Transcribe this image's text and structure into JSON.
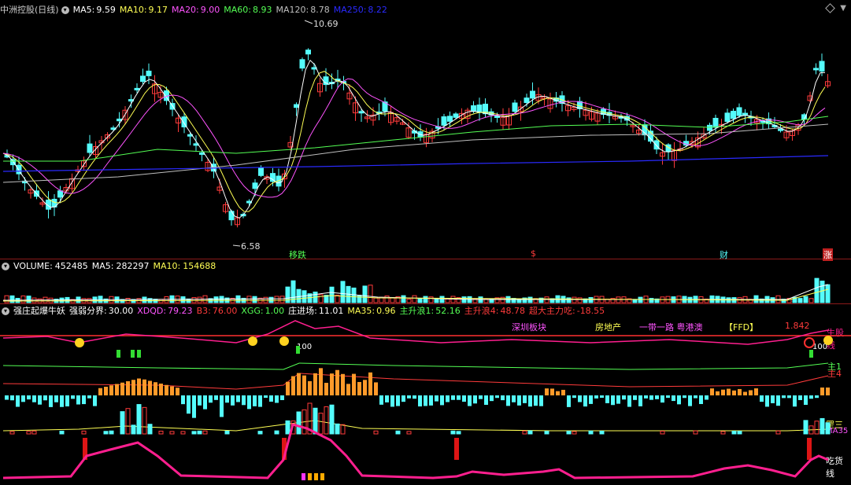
{
  "price_panel": {
    "title": "中洲控股(日线)",
    "ma5_label": "MA5:",
    "ma5": "9.59",
    "ma10_label": "MA10:",
    "ma10": "9.17",
    "ma20_label": "MA20:",
    "ma20": "9.00",
    "ma60_label": "MA60:",
    "ma60": "8.93",
    "ma120_label": "MA120:",
    "ma120": "8.78",
    "ma250_label": "MA250:",
    "ma250": "8.22",
    "high_label": "10.69",
    "low_label": "6.58",
    "events": [
      "移跌",
      "$",
      "财",
      "涨"
    ]
  },
  "volume_panel": {
    "volume_label": "VOLUME:",
    "volume": "452485",
    "ma5_label": "MA5:",
    "ma5": "282297",
    "ma10_label": "MA10:",
    "ma10": "154688"
  },
  "indicator_panel": {
    "name": "强庄起爆牛妖",
    "s1_label": "强弱分界:",
    "s1": "30.00",
    "s2_label": "XDQD:",
    "s2": "79.23",
    "s3_label": "B3:",
    "s3": "76.00",
    "s4_label": "XGG:",
    "s4": "1.00",
    "s5_label": "庄进场:",
    "s5": "11.01",
    "s6_label": "MA35:",
    "s6": "0.96",
    "s7_label": "主升浪1:",
    "s7": "52.16",
    "s8_label": "主升浪4:",
    "s8": "48.78",
    "s9_label": "超大主力吃:",
    "s9": "-18.55",
    "tags": [
      "深圳板块",
      "房地产",
      "一带一路 粤港澳",
      "【FFD】",
      "1.842"
    ],
    "right_labels": [
      "生股线",
      "主1",
      "主4",
      "罡三",
      "MA35",
      "吃货线"
    ],
    "marker_values": [
      "100",
      "100"
    ]
  },
  "colors": {
    "up": "#ff3b3b",
    "down": "#54fcfc",
    "ma5": "#ffffff",
    "ma10": "#ffff54",
    "ma20": "#ff54ff",
    "ma60": "#54ff54",
    "ma120": "#bfbfbf",
    "ma250": "#2a2aff",
    "magenta": "#ff1f8f",
    "orange": "#ff9a2a"
  }
}
